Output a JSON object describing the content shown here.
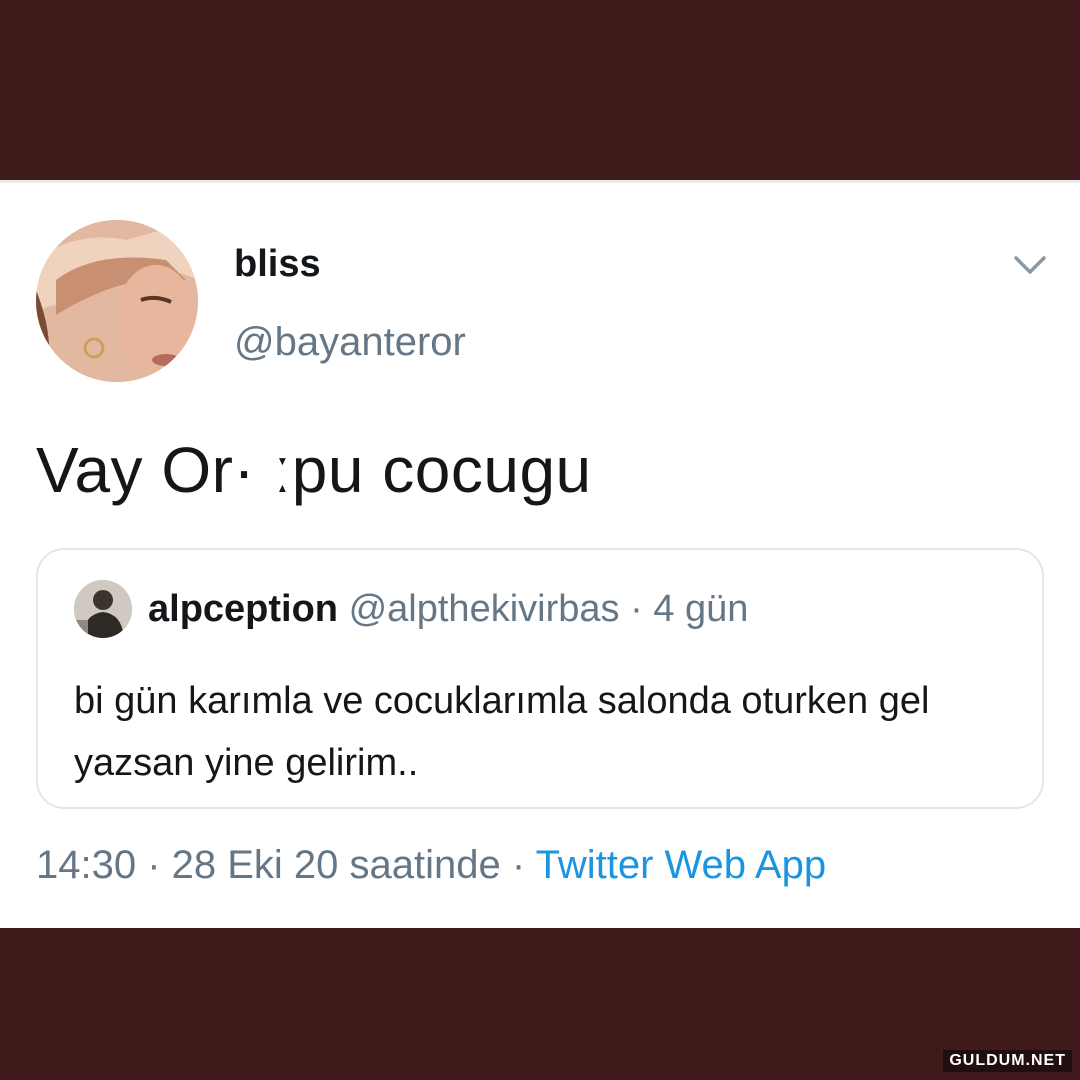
{
  "tweet": {
    "display_name": "bliss",
    "handle": "@bayanteror",
    "text": "Vay Or· ːpu cocugu",
    "footer": {
      "time_date": "14:30 · 28 Eki 20 saatinde · ",
      "source": "Twitter Web App"
    }
  },
  "quote": {
    "display_name": "alpception",
    "meta": "@alpthekivirbas · 4 gün",
    "body": "bi gün karımla ve cocuklarımla salonda oturken gel yazsan yine gelirim.."
  },
  "icons": {
    "menu": "chevron-down-icon"
  },
  "watermark": "GULDUM.NET",
  "colors": {
    "frame": "#3e1b1a",
    "card": "#ffffff",
    "text": "#14171a",
    "secondary": "#657786",
    "link": "#1b95e0",
    "border": "#e1e8ed"
  }
}
